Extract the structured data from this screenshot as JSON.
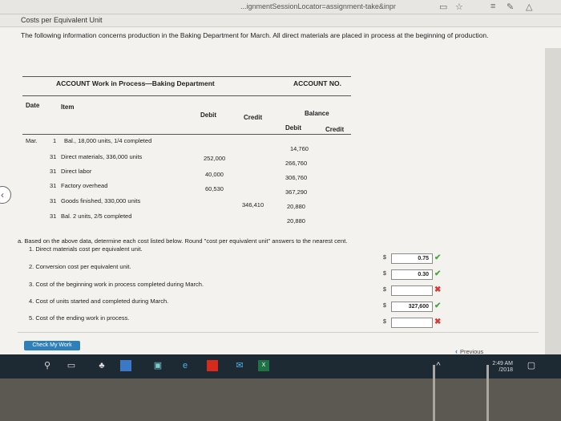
{
  "browser": {
    "url": "...ignmentSessionLocator=assignment-take&inpr"
  },
  "header": {
    "title": "Costs per Equivalent Unit"
  },
  "intro": "The following information concerns production in the Baking Department for March. All direct materials are placed in process at the beginning of production.",
  "ledger": {
    "account_title": "ACCOUNT Work in Process—Baking Department",
    "account_no_label": "ACCOUNT NO.",
    "col_date": "Date",
    "col_item": "Item",
    "col_debit": "Debit",
    "col_credit": "Credit",
    "col_balance": "Balance",
    "col_bal_debit": "Debit",
    "col_bal_credit": "Credit",
    "rows": [
      {
        "date": "Mar.",
        "day": "1",
        "item": "Bal., 18,000 units, 1/4 completed",
        "debit": "",
        "credit": "",
        "balance": "14,760"
      },
      {
        "date": "",
        "day": "31",
        "item": "Direct materials, 336,000 units",
        "debit": "252,000",
        "credit": "",
        "balance": "266,760"
      },
      {
        "date": "",
        "day": "31",
        "item": "Direct labor",
        "debit": "40,000",
        "credit": "",
        "balance": "306,760"
      },
      {
        "date": "",
        "day": "31",
        "item": "Factory overhead",
        "debit": "60,530",
        "credit": "",
        "balance": "367,290"
      },
      {
        "date": "",
        "day": "31",
        "item": "Goods finished, 330,000 units",
        "debit": "",
        "credit": "346,410",
        "balance": "20,880"
      },
      {
        "date": "",
        "day": "31",
        "item": "Bal. 2 units, 2/5 completed",
        "debit": "",
        "credit": "",
        "balance": "20,880"
      }
    ]
  },
  "instructions": "a. Based on the above data, determine each cost listed below. Round \"cost per equivalent unit\" answers to the nearest cent.",
  "questions": [
    {
      "label": "1. Direct materials cost per equivalent unit.",
      "value": "0.75",
      "status": "correct"
    },
    {
      "label": "2. Conversion cost per equivalent unit.",
      "value": "0.30",
      "status": "correct"
    },
    {
      "label": "3. Cost of the beginning work in process completed during March.",
      "value": "",
      "status": "incorrect"
    },
    {
      "label": "4. Cost of units started and completed during March.",
      "value": "327,600",
      "status": "correct"
    },
    {
      "label": "5. Cost of the ending work in process.",
      "value": "",
      "status": "incorrect"
    }
  ],
  "currency_symbol": "$",
  "marks": {
    "correct": "✔",
    "incorrect": "✖"
  },
  "buttons": {
    "check_work": "Check My Work",
    "previous": "Previous"
  },
  "taskbar": {
    "time": "2:49 AM",
    "date": "/2018"
  },
  "colors": {
    "check": "#4aa73c",
    "cross": "#d53b34",
    "accent": "#2f7fb9"
  }
}
